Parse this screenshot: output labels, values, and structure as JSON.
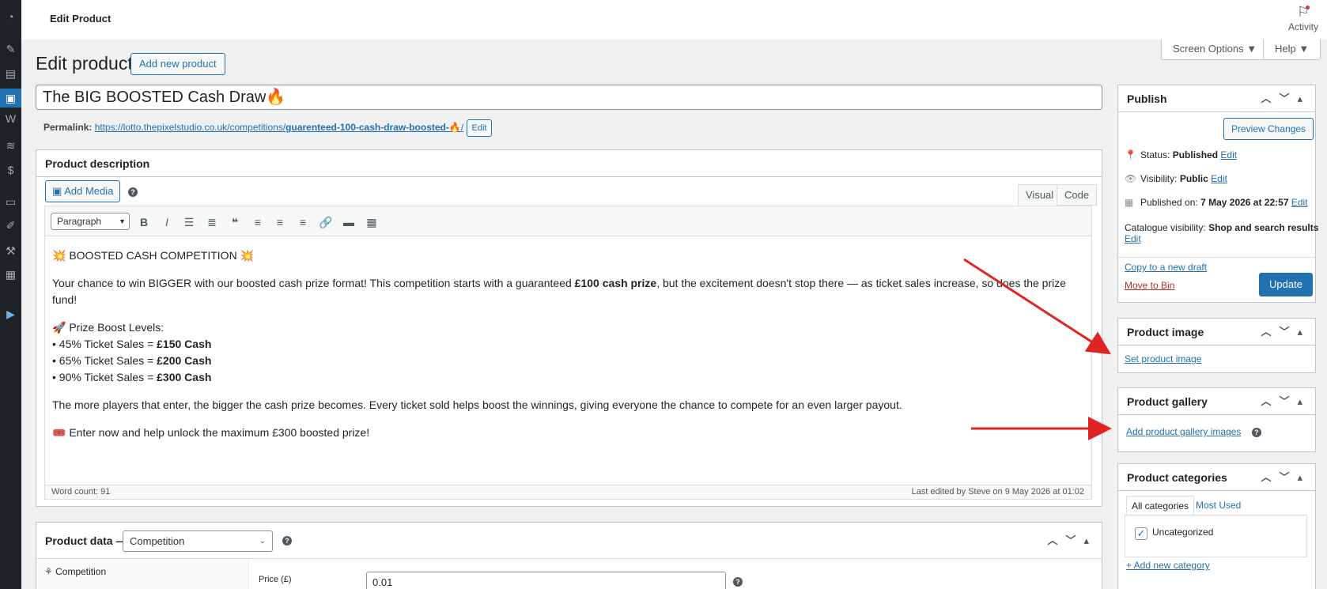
{
  "topbar": {
    "title": "Edit Product",
    "activity_label": "Activity"
  },
  "screen_options": "Screen Options ▼",
  "help": "Help ▼",
  "heading": "Edit product",
  "add_new_button": "Add new product",
  "product_title": "The BIG BOOSTED Cash Draw🔥",
  "permalink": {
    "label": "Permalink:",
    "base": "https://lotto.thepixelstudio.co.uk/competitions/",
    "slug": "guarenteed-100-cash-draw-boosted-🔥",
    "tail": "/",
    "edit": "Edit"
  },
  "description": {
    "title": "Product description",
    "add_media": "Add Media",
    "tab_visual": "Visual",
    "tab_code": "Code",
    "format": "Paragraph",
    "content": {
      "p1": "💥 BOOSTED CASH COMPETITION 💥",
      "p2a": "Your chance to win BIGGER with our boosted cash prize format! This competition starts with a guaranteed ",
      "p2b": "£100 cash prize",
      "p2c": ", but the excitement doesn't stop there — as ticket sales increase, so does the prize fund!",
      "levels_title": "🚀 Prize Boost Levels:",
      "levels": [
        {
          "pre": "• 45% Ticket Sales = ",
          "bold": "£150 Cash"
        },
        {
          "pre": "• 65% Ticket Sales = ",
          "bold": "£200 Cash"
        },
        {
          "pre": "• 90% Ticket Sales = ",
          "bold": "£300 Cash"
        }
      ],
      "p4": "The more players that enter, the bigger the cash prize becomes. Every ticket sold helps boost the winnings, giving everyone the chance to compete for an even larger payout.",
      "p5": "🎟️ Enter now and help unlock the maximum £300 boosted prize!"
    },
    "word_count": "Word count: 91",
    "last_edited": "Last edited by Steve on 9 May 2026 at 01:02"
  },
  "product_data": {
    "label": "Product data —",
    "type": "Competition",
    "tab_competition": "Competition",
    "price_label": "Price (£)",
    "price_value": "0.01"
  },
  "publish": {
    "title": "Publish",
    "preview": "Preview Changes",
    "status_label": "Status:",
    "status_value": "Published",
    "visibility_label": "Visibility:",
    "visibility_value": "Public",
    "published_label": "Published on:",
    "published_value": "7 May 2026 at 22:57",
    "catalogue_label": "Catalogue visibility:",
    "catalogue_value": "Shop and search results",
    "edit": "Edit",
    "copy_draft": "Copy to a new draft",
    "move_bin": "Move to Bin",
    "update": "Update"
  },
  "product_image": {
    "title": "Product image",
    "link": "Set product image"
  },
  "product_gallery": {
    "title": "Product gallery",
    "link": "Add product gallery images"
  },
  "product_categories": {
    "title": "Product categories",
    "tab_all": "All categories",
    "tab_used": "Most Used",
    "item": "Uncategorized",
    "add_new": "+ Add new category"
  },
  "colors": {
    "accent": "#2271b1",
    "sidebar": "#1d2327",
    "annotation": "#e02424"
  }
}
